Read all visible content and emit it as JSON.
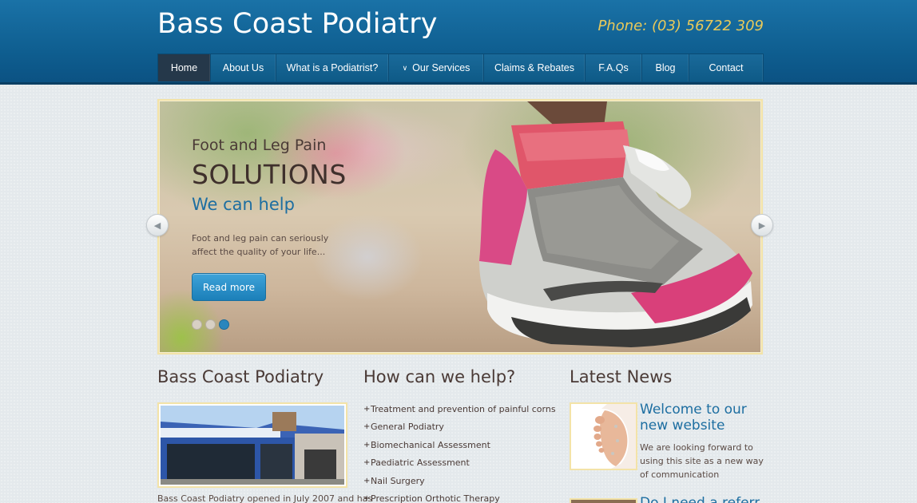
{
  "header": {
    "site_title": "Bass Coast Podiatry",
    "phone": "Phone: (03) 56722 309"
  },
  "nav": {
    "items": [
      {
        "label": "Home",
        "active": true
      },
      {
        "label": "About Us"
      },
      {
        "label": "What is a Podiatrist?"
      },
      {
        "label": "Our Services",
        "has_dropdown": true
      },
      {
        "label": "Claims & Rebates"
      },
      {
        "label": "F.A.Qs"
      },
      {
        "label": "Blog"
      },
      {
        "label": "Contact"
      }
    ]
  },
  "slider": {
    "line1": "Foot and Leg Pain",
    "line2": "SOLUTIONS",
    "line3": "We can help",
    "body": "Foot and leg pain can seriously affect the quality of your life...",
    "button": "Read more",
    "active_slide": 3,
    "slide_count": 3
  },
  "about": {
    "title": "Bass Coast Podiatry",
    "text": "Bass Coast Podiatry opened in July 2007 and has"
  },
  "help": {
    "title": "How can we help?",
    "items": [
      "Treatment and prevention of painful corns",
      "General Podiatry",
      "Biomechanical Assessment",
      "Paediatric Assessment",
      "Nail Surgery",
      "Prescription Orthotic Therapy"
    ]
  },
  "news": {
    "title": "Latest News",
    "items": [
      {
        "title": "Welcome to our new website",
        "body": "We are looking forward to using this site as a new way of communication"
      },
      {
        "title": "Do I need a referral f..."
      }
    ]
  },
  "colors": {
    "header_blue": "#0f5f91",
    "accent_blue": "#1d6ea1",
    "phone_gold": "#e8c95a",
    "frame_gold": "#f3e3a8"
  }
}
